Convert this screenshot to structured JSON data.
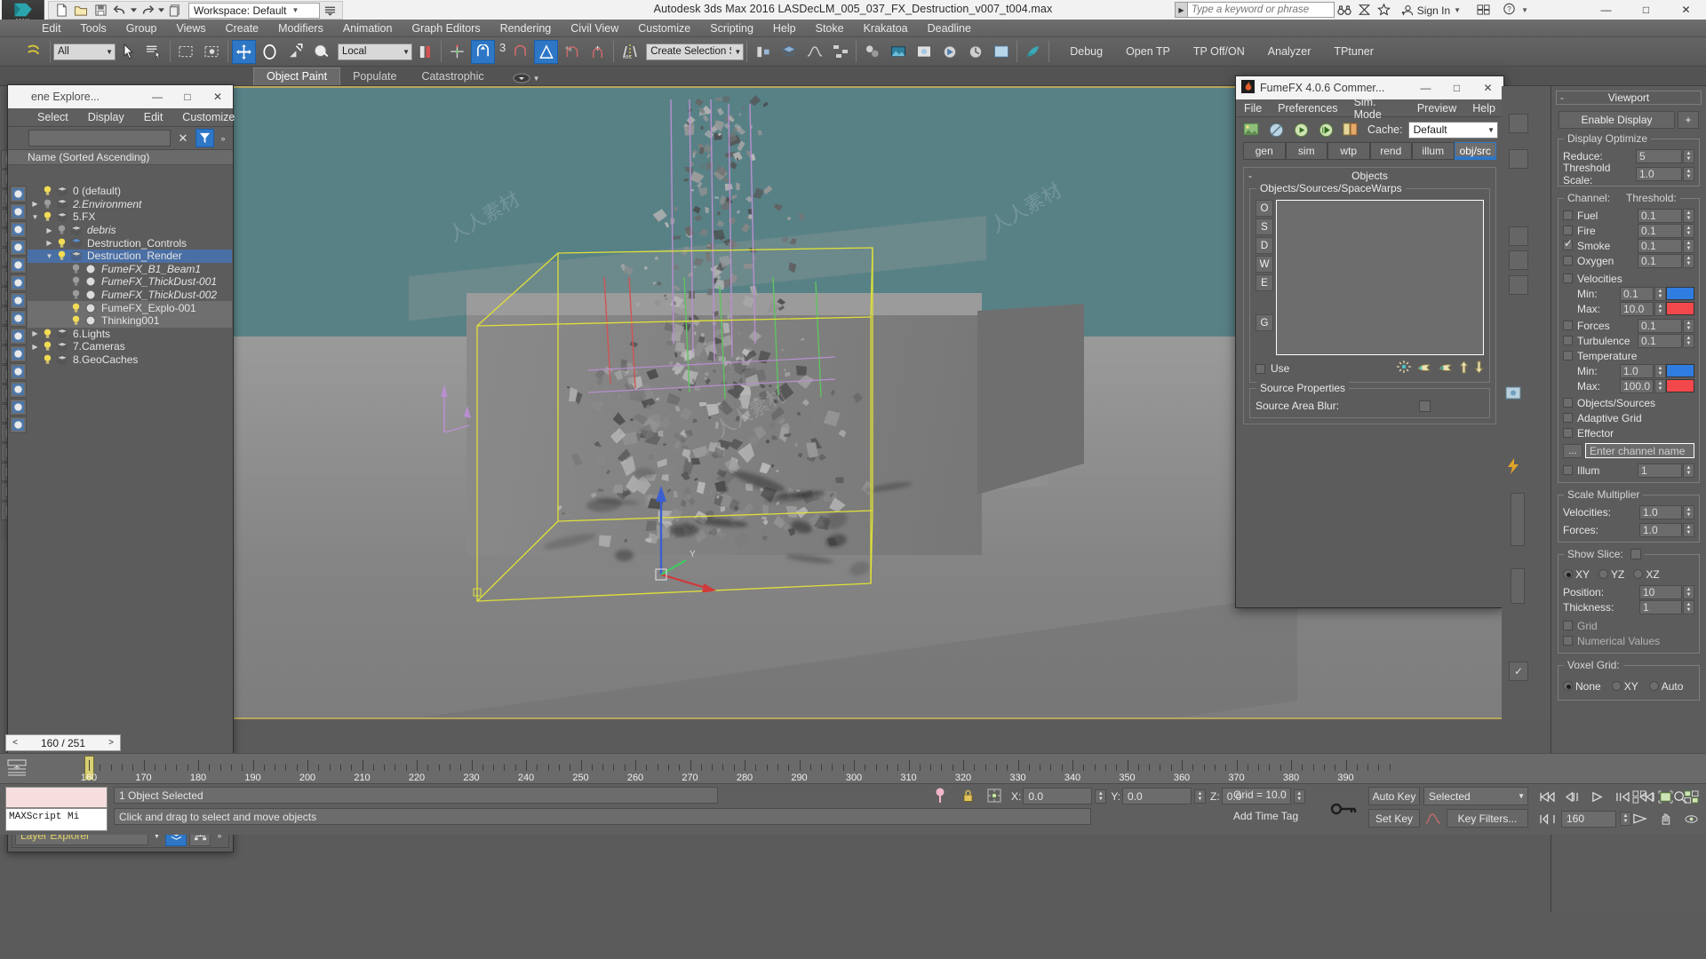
{
  "titlebar": {
    "app_title": "Autodesk 3ds Max 2016    LASDecLM_005_037_FX_Destruction_v007_t004.max",
    "workspace": "Workspace: Default",
    "search_placeholder": "Type a keyword or phrase",
    "signin": "Sign In",
    "logo_text": "MAX",
    "minimize": "—",
    "maximize": "□",
    "close": "✕"
  },
  "menubar": {
    "items": [
      "Edit",
      "Tools",
      "Group",
      "Views",
      "Create",
      "Modifiers",
      "Animation",
      "Graph Editors",
      "Rendering",
      "Civil View",
      "Customize",
      "Scripting",
      "Help",
      "Stoke",
      "Krakatoa",
      "Deadline"
    ]
  },
  "maintoolbar": {
    "selection_filter": "All",
    "coord_system": "Local",
    "named_selection_set": "Create Selection Se",
    "named_set_placeholder": "Create Selection Set",
    "array_count": "3",
    "right_labels": [
      "Debug",
      "Open TP",
      "TP Off/ON",
      "Analyzer",
      "TPtuner"
    ]
  },
  "ribbon": {
    "tabs": [
      {
        "label": "Object Paint",
        "active": true
      },
      {
        "label": "Populate",
        "active": false
      },
      {
        "label": "Catastrophic",
        "active": false
      }
    ]
  },
  "scene_explorer": {
    "window_title": "ene Explore...",
    "minimize": "—",
    "maximize": "□",
    "close": "✕",
    "menu": [
      "Select",
      "Display",
      "Edit",
      "Customize"
    ],
    "column_header": "Name (Sorted Ascending)",
    "footer_label": "Layer Explorer",
    "clear_icon": "✕",
    "tree": [
      {
        "label": "0 (default)",
        "indent": 0,
        "expander": "",
        "bulb": "on",
        "icon": "layer",
        "italic": false,
        "state": "normal"
      },
      {
        "label": "2.Environment",
        "indent": 0,
        "expander": "▶",
        "bulb": "off",
        "icon": "layer",
        "italic": true,
        "state": "normal"
      },
      {
        "label": "5.FX",
        "indent": 0,
        "expander": "▼",
        "bulb": "on",
        "icon": "layer",
        "italic": false,
        "state": "normal"
      },
      {
        "label": "debris",
        "indent": 1,
        "expander": "▶",
        "bulb": "off",
        "icon": "layer",
        "italic": true,
        "state": "normal"
      },
      {
        "label": "Destruction_Controls",
        "indent": 1,
        "expander": "▶",
        "bulb": "on",
        "icon": "layer-blue",
        "italic": false,
        "state": "normal"
      },
      {
        "label": "Destruction_Render",
        "indent": 1,
        "expander": "▼",
        "bulb": "on",
        "icon": "layer",
        "italic": false,
        "state": "selected"
      },
      {
        "label": "FumeFX_B1_Beam1",
        "indent": 2,
        "expander": "",
        "bulb": "off",
        "icon": "obj",
        "italic": true,
        "state": "normal"
      },
      {
        "label": "FumeFX_ThickDust-001",
        "indent": 2,
        "expander": "",
        "bulb": "off",
        "icon": "obj",
        "italic": true,
        "state": "normal"
      },
      {
        "label": "FumeFX_ThickDust-002",
        "indent": 2,
        "expander": "",
        "bulb": "off",
        "icon": "obj",
        "italic": true,
        "state": "normal"
      },
      {
        "label": "FumeFX_Explo-001",
        "indent": 2,
        "expander": "",
        "bulb": "on",
        "icon": "obj",
        "italic": false,
        "state": "highlight"
      },
      {
        "label": "Thinking001",
        "indent": 2,
        "expander": "",
        "bulb": "on",
        "icon": "obj",
        "italic": false,
        "state": "highlight"
      },
      {
        "label": "6.Lights",
        "indent": 0,
        "expander": "▶",
        "bulb": "on",
        "icon": "layer",
        "italic": false,
        "state": "normal"
      },
      {
        "label": "7.Cameras",
        "indent": 0,
        "expander": "▶",
        "bulb": "on",
        "icon": "layer",
        "italic": false,
        "state": "normal"
      },
      {
        "label": "8.GeoCaches",
        "indent": 0,
        "expander": "",
        "bulb": "on",
        "icon": "layer",
        "italic": false,
        "state": "normal"
      }
    ]
  },
  "fumefx": {
    "window_title": "FumeFX 4.0.6 Commer...",
    "minimize": "—",
    "maximize": "□",
    "close": "✕",
    "menu": [
      "File",
      "Preferences",
      "Sim. Mode",
      "Preview",
      "Help"
    ],
    "cache_label": "Cache:",
    "cache_value": "Default",
    "tabs": [
      {
        "label": "gen",
        "active": false
      },
      {
        "label": "sim",
        "active": false
      },
      {
        "label": "wtp",
        "active": false
      },
      {
        "label": "rend",
        "active": false
      },
      {
        "label": "illum",
        "active": false
      },
      {
        "label": "obj/src",
        "active": true
      }
    ],
    "rollout_title": "Objects",
    "rollout_minus": "-",
    "group_label": "Objects/Sources/SpaceWarps",
    "side_buttons": [
      "O",
      "S",
      "D",
      "W",
      "E",
      "G"
    ],
    "use_label": "Use",
    "source_props_label": "Source Properties",
    "source_area_blur_label": "Source Area Blur:"
  },
  "command_panel": {
    "rollout_title": "Viewport",
    "rollout_minus": "-",
    "enable_display": "Enable Display",
    "enable_display_plus": "+",
    "display_optimize_label": "Display Optimize",
    "reduce_label": "Reduce:",
    "reduce_value": "5",
    "threshold_scale_label": "Threshold Scale:",
    "threshold_scale_value": "1.0",
    "channel_label": "Channel:",
    "threshold_label": "Threshold:",
    "channels": [
      {
        "name": "Fuel",
        "checked": false,
        "value": "0.1"
      },
      {
        "name": "Fire",
        "checked": false,
        "value": "0.1"
      },
      {
        "name": "Smoke",
        "checked": true,
        "value": "0.1"
      },
      {
        "name": "Oxygen",
        "checked": false,
        "value": "0.1"
      }
    ],
    "velocities_label": "Velocities",
    "velocities_checked": false,
    "vel_min_label": "Min:",
    "vel_min_value": "0.1",
    "vel_min_color": "#2f7de0",
    "vel_max_label": "Max:",
    "vel_max_value": "10.0",
    "vel_max_color": "#f2484c",
    "forces_label": "Forces",
    "forces_value": "0.1",
    "forces_checked": false,
    "turbulence_label": "Turbulence",
    "turbulence_value": "0.1",
    "turbulence_checked": false,
    "temperature_label": "Temperature",
    "temperature_checked": false,
    "temp_min_label": "Min:",
    "temp_min_value": "1.0",
    "temp_min_color": "#2f7de0",
    "temp_max_label": "Max:",
    "temp_max_value": "100.0",
    "temp_max_color": "#f2484c",
    "objects_sources_label": "Objects/Sources",
    "objects_sources_checked": false,
    "adaptive_grid_label": "Adaptive Grid",
    "adaptive_grid_checked": false,
    "effector_label": "Effector",
    "effector_checked": false,
    "channel_name_btn": "...",
    "channel_name_placeholder": "Enter channel name",
    "illum_label": "Illum",
    "illum_value": "1",
    "illum_checked": false,
    "scale_mult_label": "Scale Multiplier",
    "scale_vel_label": "Velocities:",
    "scale_vel_value": "1.0",
    "scale_forces_label": "Forces:",
    "scale_forces_value": "1.0",
    "show_slice_label": "Show Slice:",
    "show_slice_checked": false,
    "slice_planes": [
      {
        "label": "XY",
        "selected": true
      },
      {
        "label": "YZ",
        "selected": false
      },
      {
        "label": "XZ",
        "selected": false
      }
    ],
    "position_label": "Position:",
    "position_value": "10",
    "thickness_label": "Thickness:",
    "thickness_value": "1",
    "grid_label": "Grid",
    "grid_checked": false,
    "numerical_values_label": "Numerical Values",
    "numerical_values_checked": false,
    "voxel_grid_label": "Voxel Grid:",
    "voxel_options": [
      {
        "label": "None",
        "selected": true
      },
      {
        "label": "XY",
        "selected": false
      },
      {
        "label": "Auto",
        "selected": false
      }
    ]
  },
  "timeline": {
    "frame_display": "160 / 251",
    "prev_arrow": "<",
    "next_arrow": ">",
    "ticks": [
      160,
      170,
      180,
      190,
      200,
      210,
      220,
      230,
      240,
      250,
      260,
      270,
      280,
      290,
      300,
      310,
      320,
      330,
      340,
      350,
      360,
      370,
      380,
      390
    ],
    "playhead_frame": 160
  },
  "statusbar": {
    "selection_info": "1 Object Selected",
    "prompt": "Click and drag to select and move objects",
    "script_label": "MAXScript Mi",
    "x_label": "X:",
    "x_value": "0.0",
    "y_label": "Y:",
    "y_value": "0.0",
    "z_label": "Z:",
    "z_value": "0.0",
    "grid_text": "Grid = 10.0",
    "add_time_tag": "Add Time Tag",
    "auto_key": "Auto Key",
    "set_key": "Set Key",
    "key_filters": "Key Filters...",
    "selected_dropdown": "Selected",
    "current_frame": "160"
  },
  "watermarks": [
    "人人素材",
    "人人素材",
    "人人素材"
  ],
  "colors": {
    "accent_blue": "#2e77c7",
    "selection_yellow": "#e0e03a",
    "sky": "#588186",
    "floor": "#8e8e8e"
  }
}
